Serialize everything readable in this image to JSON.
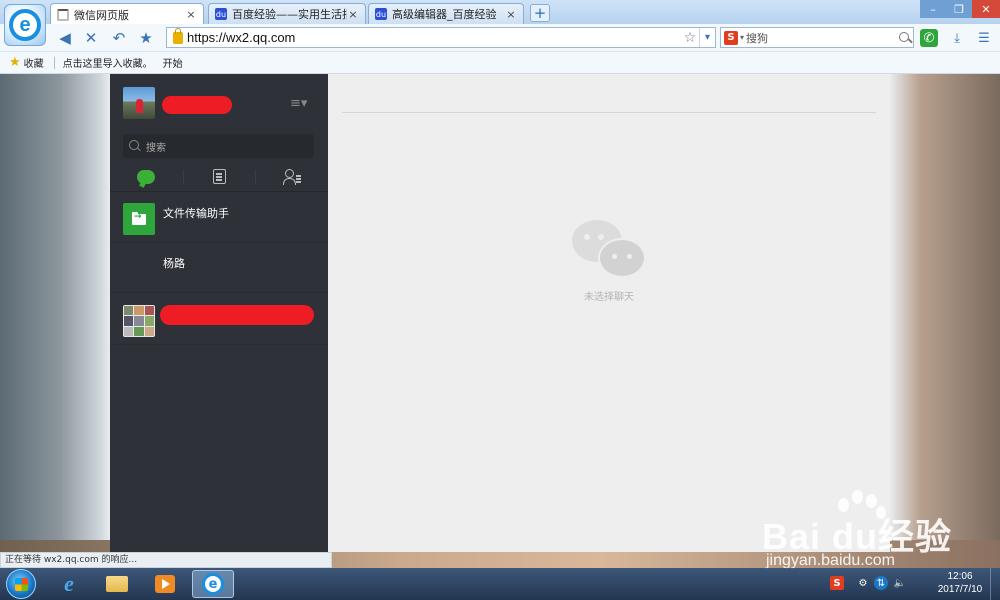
{
  "browser": {
    "tabs": [
      {
        "label": "微信网页版",
        "close": "×"
      },
      {
        "label": "百度经验——实用生活指南",
        "close": "×"
      },
      {
        "label": "高级编辑器_百度经验",
        "close": "×"
      }
    ],
    "new_tab": "+",
    "window": {
      "minimize": "–",
      "maximize": "❐",
      "close": "✕"
    },
    "nav": {
      "back": "◀",
      "stop": "✕",
      "undo": "↶",
      "favorite": "★"
    },
    "url": "https://wx2.qq.com",
    "address_star": "☆",
    "address_dropdown": "▾",
    "search": {
      "engine_logo": "S",
      "dropdown": "▾",
      "placeholder": "搜狗"
    },
    "tools": {
      "phone": "✆",
      "download": "⤓",
      "menu": "☰"
    },
    "bookmarks": {
      "star": "★",
      "items": [
        "收藏",
        "点击这里导入收藏。",
        "开始"
      ]
    },
    "status": "正在等待 wx2.qq.com 的响应..."
  },
  "wechat": {
    "menu_icon": "≡▾",
    "search_placeholder": "搜索",
    "chats": [
      {
        "name": "文件传输助手"
      },
      {
        "name": "杨路"
      }
    ],
    "empty_state": "未选择聊天"
  },
  "watermark": {
    "text": "Bai du经验",
    "sub": "jingyan.baidu.com"
  },
  "taskbar": {
    "tray": {
      "sogou": "S",
      "ime": "⚙",
      "network": "⇅",
      "volume": "🔈"
    },
    "time": "12:06",
    "date": "2017/7/10"
  },
  "colors": {
    "wechat_sidebar": "#2e3238",
    "wechat_green": "#3caf36",
    "wechat_main": "#eeeeee",
    "redaction": "#ee1c25"
  }
}
